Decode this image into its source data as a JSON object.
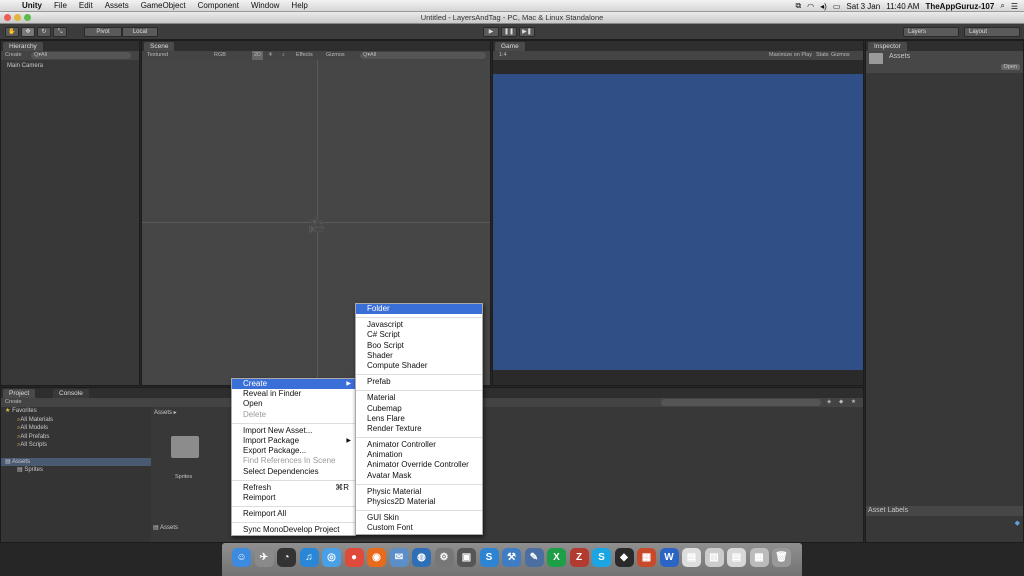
{
  "menubar": {
    "apple": "",
    "items": [
      "Unity",
      "File",
      "Edit",
      "Assets",
      "GameObject",
      "Component",
      "Window",
      "Help"
    ],
    "date": "Sat 3 Jan",
    "time": "11:40 AM",
    "user": "TheAppGuruz-107"
  },
  "window": {
    "title": "Untitled - LayersAndTag - PC, Mac & Linux Standalone"
  },
  "toolbar": {
    "pivot": "Pivot",
    "local": "Local",
    "layers": "Layers",
    "layout": "Layout"
  },
  "hierarchy": {
    "tab": "Hierarchy",
    "create": "Create",
    "search_placeholder": "Q▾All",
    "items": [
      "Main Camera"
    ]
  },
  "scene": {
    "tab": "Scene",
    "shading": "Textured",
    "mode": "RGB",
    "toggle2d": "2D",
    "effects": "Effects",
    "gizmos": "Gizmos",
    "search_placeholder": "Q▾All"
  },
  "game": {
    "tab": "Game",
    "aspect": "1:4",
    "maximize": "Maximize on Play",
    "stats": "Stats",
    "gizmos": "Gizmos",
    "bg": "#2f4f86"
  },
  "inspector": {
    "tab": "Inspector",
    "title": "Assets",
    "open": "Open",
    "asset_labels": "Asset Labels"
  },
  "project": {
    "tab": "Project",
    "console_tab": "Console",
    "create": "Create",
    "breadcrumb": "Assets ▸",
    "favorites_label": "Favorites",
    "favorites": [
      "All Materials",
      "All Models",
      "All Prefabs",
      "All Scripts"
    ],
    "assets_label": "Assets",
    "asset_children": [
      "Sprites"
    ],
    "grid_item": "Sprites",
    "footer": "Assets"
  },
  "context_menu": [
    {
      "label": "Create",
      "state": "highlight",
      "submenu": true
    },
    {
      "label": "Reveal in Finder"
    },
    {
      "label": "Open"
    },
    {
      "label": "Delete",
      "state": "disabled"
    },
    {
      "sep": true
    },
    {
      "label": "Import New Asset..."
    },
    {
      "label": "Import Package",
      "submenu": true
    },
    {
      "label": "Export Package..."
    },
    {
      "label": "Find References In Scene",
      "state": "disabled"
    },
    {
      "label": "Select Dependencies"
    },
    {
      "sep": true
    },
    {
      "label": "Refresh",
      "shortcut": "⌘R"
    },
    {
      "label": "Reimport"
    },
    {
      "sep": true
    },
    {
      "label": "Reimport All"
    },
    {
      "sep": true
    },
    {
      "label": "Sync MonoDevelop Project"
    }
  ],
  "create_submenu": [
    {
      "label": "Folder",
      "state": "highlight"
    },
    {
      "sep": true
    },
    {
      "label": "Javascript"
    },
    {
      "label": "C# Script"
    },
    {
      "label": "Boo Script"
    },
    {
      "label": "Shader"
    },
    {
      "label": "Compute Shader"
    },
    {
      "sep": true
    },
    {
      "label": "Prefab"
    },
    {
      "sep": true
    },
    {
      "label": "Material"
    },
    {
      "label": "Cubemap"
    },
    {
      "label": "Lens Flare"
    },
    {
      "label": "Render Texture"
    },
    {
      "sep": true
    },
    {
      "label": "Animator Controller"
    },
    {
      "label": "Animation"
    },
    {
      "label": "Animator Override Controller"
    },
    {
      "label": "Avatar Mask"
    },
    {
      "sep": true
    },
    {
      "label": "Physic Material"
    },
    {
      "label": "Physics2D Material"
    },
    {
      "sep": true
    },
    {
      "label": "GUI Skin"
    },
    {
      "label": "Custom Font"
    }
  ],
  "dock": [
    {
      "name": "finder-icon",
      "color": "#3d8be0",
      "glyph": "☺"
    },
    {
      "name": "launchpad-icon",
      "color": "#8a8a8a",
      "glyph": "✈"
    },
    {
      "name": "dashboard-icon",
      "color": "#333333",
      "glyph": "◔"
    },
    {
      "name": "itunes-icon",
      "color": "#2a86d6",
      "glyph": "♫"
    },
    {
      "name": "safari-icon",
      "color": "#4aa0e6",
      "glyph": "◎"
    },
    {
      "name": "chrome-icon",
      "color": "#e04a3a",
      "glyph": "●"
    },
    {
      "name": "firefox-icon",
      "color": "#e86b1d",
      "glyph": "◉"
    },
    {
      "name": "mail-icon",
      "color": "#5c8fc7",
      "glyph": "✉"
    },
    {
      "name": "globe-icon",
      "color": "#2f6fb8",
      "glyph": "◍"
    },
    {
      "name": "monodevelop-icon",
      "color": "#777777",
      "glyph": "⚙"
    },
    {
      "name": "photobooth-icon",
      "color": "#555555",
      "glyph": "▣"
    },
    {
      "name": "sourcetree-icon",
      "color": "#2d84d2",
      "glyph": "S"
    },
    {
      "name": "xcode-icon",
      "color": "#3f7cc4",
      "glyph": "⚒"
    },
    {
      "name": "textwrangler-icon",
      "color": "#4b6fa3",
      "glyph": "✎"
    },
    {
      "name": "excel-icon",
      "color": "#1f9e48",
      "glyph": "X"
    },
    {
      "name": "filezilla-icon",
      "color": "#b23a2e",
      "glyph": "Z"
    },
    {
      "name": "skype-icon",
      "color": "#1ba6e3",
      "glyph": "S"
    },
    {
      "name": "unity-icon",
      "color": "#2a2a2a",
      "glyph": "◆"
    },
    {
      "name": "texturepacker-icon",
      "color": "#c84a2a",
      "glyph": "▦"
    },
    {
      "name": "word-icon",
      "color": "#2b64c5",
      "glyph": "W"
    },
    {
      "name": "document-icon",
      "color": "#dddddd",
      "glyph": "▤"
    },
    {
      "name": "preview-icon",
      "color": "#cccccc",
      "glyph": "▥"
    },
    {
      "name": "notes-icon",
      "color": "#d8d8d8",
      "glyph": "▤"
    },
    {
      "name": "stacks-icon",
      "color": "#bbbbbb",
      "glyph": "▦"
    },
    {
      "name": "trash-icon",
      "color": "#999999",
      "glyph": "🗑"
    }
  ]
}
